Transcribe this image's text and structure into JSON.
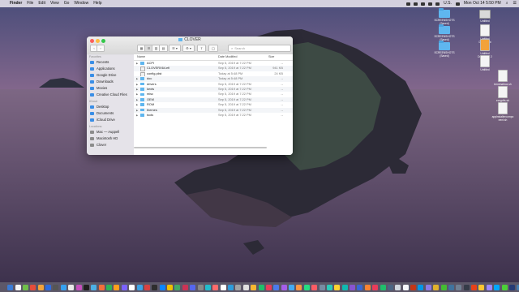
{
  "menubar": {
    "apple_glyph": "",
    "items": [
      "Finder",
      "File",
      "Edit",
      "View",
      "Go",
      "Window",
      "Help"
    ],
    "input_source": "U.S.",
    "clock": "Mon Oct 14  5:50 PM"
  },
  "desktop_icons": [
    {
      "kind": "folder",
      "label": "SCREENSHOTS\n(Saved)"
    },
    {
      "kind": "disk",
      "label": "Untitled"
    },
    {
      "kind": "folder",
      "label": "SCREENSHOTS\n(Saved)"
    },
    {
      "kind": "doc",
      "label": "Untitled\nDocument"
    },
    {
      "kind": "folder",
      "label": "SCREENSHOTS\n(Saved)"
    },
    {
      "kind": "doc",
      "label": "Untitled\nDocument 2"
    },
    {
      "kind": "doc",
      "label": "Untitled"
    },
    {
      "kind": "doc",
      "label": "terminalbox.sh"
    },
    {
      "kind": "doc",
      "label": "ecryptfs.sh"
    },
    {
      "kind": "doc",
      "label": "appinstallercompo\nnent.sh"
    }
  ],
  "finder": {
    "title": "CLOVER",
    "search_placeholder": "Search",
    "toolbar": {
      "back": "‹",
      "forward": "›",
      "view_icons": "▦",
      "view_list": "☰",
      "view_columns": "▥",
      "view_gallery": "▤",
      "group": "☰ ▾",
      "action": "⚙ ▾",
      "share": "⇪",
      "tags": "◯"
    },
    "sidebar": {
      "favorites_header": "Favorites",
      "favorites": [
        "Recents",
        "Applications",
        "Google Drive",
        "Downloads",
        "Movies",
        "Creative Cloud Files"
      ],
      "icloud_header": "iCloud",
      "icloud": [
        "Desktop",
        "Documents",
        "iCloud Drive"
      ],
      "locations_header": "Locations",
      "locations": [
        "Mac — Auppell",
        "Macintosh HD",
        "Clover"
      ]
    },
    "columns": {
      "name": "Name",
      "date": "Date Modified",
      "size": "Size"
    },
    "files": [
      {
        "name": "ACPI",
        "date": "Sep 5, 2019 at 7:22 PM",
        "size": "--",
        "folder": true
      },
      {
        "name": "CLOVERX64.efi",
        "date": "Sep 5, 2019 at 7:22 PM",
        "size": "941 KB",
        "folder": false
      },
      {
        "name": "config.plist",
        "date": "Today at 5:48 PM",
        "size": "24 KB",
        "folder": false
      },
      {
        "name": "doc",
        "date": "Today at 5:48 PM",
        "size": "--",
        "folder": true
      },
      {
        "name": "drivers",
        "date": "Sep 5, 2019 at 7:22 PM",
        "size": "--",
        "folder": true
      },
      {
        "name": "kexts",
        "date": "Sep 5, 2019 at 7:22 PM",
        "size": "--",
        "folder": true
      },
      {
        "name": "misc",
        "date": "Sep 5, 2019 at 7:22 PM",
        "size": "--",
        "folder": true
      },
      {
        "name": "OEM",
        "date": "Sep 5, 2019 at 7:22 PM",
        "size": "--",
        "folder": true
      },
      {
        "name": "ROM",
        "date": "Sep 5, 2019 at 7:22 PM",
        "size": "--",
        "folder": true
      },
      {
        "name": "themes",
        "date": "Sep 5, 2019 at 7:22 PM",
        "size": "--",
        "folder": true
      },
      {
        "name": "tools",
        "date": "Sep 5, 2019 at 7:22 PM",
        "size": "--",
        "folder": true
      }
    ]
  },
  "colors": {
    "folder_blue": "#5fb6ef",
    "sidebar_accent": "#3a8ee6",
    "close": "#fc605b",
    "minimize": "#fdbc40",
    "zoom": "#34c84a"
  },
  "dock_icon_colors": [
    "#3a7bd5",
    "#f5f5f5",
    "#6fbf4a",
    "#e44d3a",
    "#f2a33a",
    "#2d6cdf",
    "#555555",
    "#35a0f0",
    "#e9e9e9",
    "#c64fbd",
    "#1f1f1f",
    "#4cafe6",
    "#f36f3a",
    "#2fb457",
    "#ff9f1c",
    "#7b61ff",
    "#ffffff",
    "#3ba3e6",
    "#d94141",
    "#2e2e2e",
    "#0a84ff",
    "#f0c000",
    "#44aa66",
    "#cc3355",
    "#5566ee",
    "#888888",
    "#22bbcc",
    "#ff6b6b",
    "#ffffff",
    "#2d9cdb",
    "#a3a3a3",
    "#e0e0e0",
    "#f7b731",
    "#20bf6b",
    "#eb3b5a",
    "#4b7bec",
    "#a55eea",
    "#45aaf2",
    "#fd9644",
    "#26de81",
    "#fc5c65",
    "#778ca3",
    "#2bcbba",
    "#fed330",
    "#0fb9b1",
    "#8854d0",
    "#3867d6",
    "#fa8231",
    "#eb3b5a",
    "#20bf6b",
    "#4b6584",
    "#d1d8e0",
    "#f5f6fa",
    "#c23616",
    "#0097e6",
    "#8c7ae6",
    "#e1b12c",
    "#44bd32",
    "#40739e",
    "#718093",
    "#353b48",
    "#e84118",
    "#fbc531",
    "#9c88ff",
    "#00a8ff",
    "#4cd137",
    "#273c75",
    "#487eb0",
    "#dcdde1",
    "#7f8fa6"
  ]
}
